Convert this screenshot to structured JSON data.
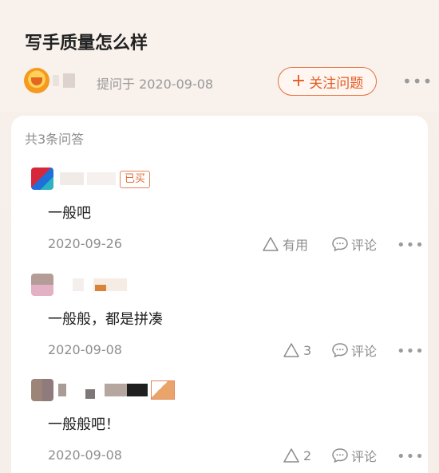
{
  "question": {
    "title": "写手质量怎么样",
    "ask_date": "提问于 2020-09-08",
    "follow_label": "关注问题",
    "follow_icon": "plus-icon",
    "more_icon": "more-icon"
  },
  "answers_count": "共3条问答",
  "answers": [
    {
      "badge": "已买",
      "text": "一般吧",
      "date": "2020-09-26",
      "useful": "有用",
      "comment": "评论"
    },
    {
      "text": "一般般，都是拼凑",
      "date": "2020-09-08",
      "useful": "3",
      "comment": "评论"
    },
    {
      "text": "一般般吧！",
      "date": "2020-09-08",
      "useful": "2",
      "comment": "评论"
    }
  ],
  "colors": {
    "accent": "#e25a22",
    "background": "#f8f1ec",
    "muted": "#8c8c8c"
  }
}
